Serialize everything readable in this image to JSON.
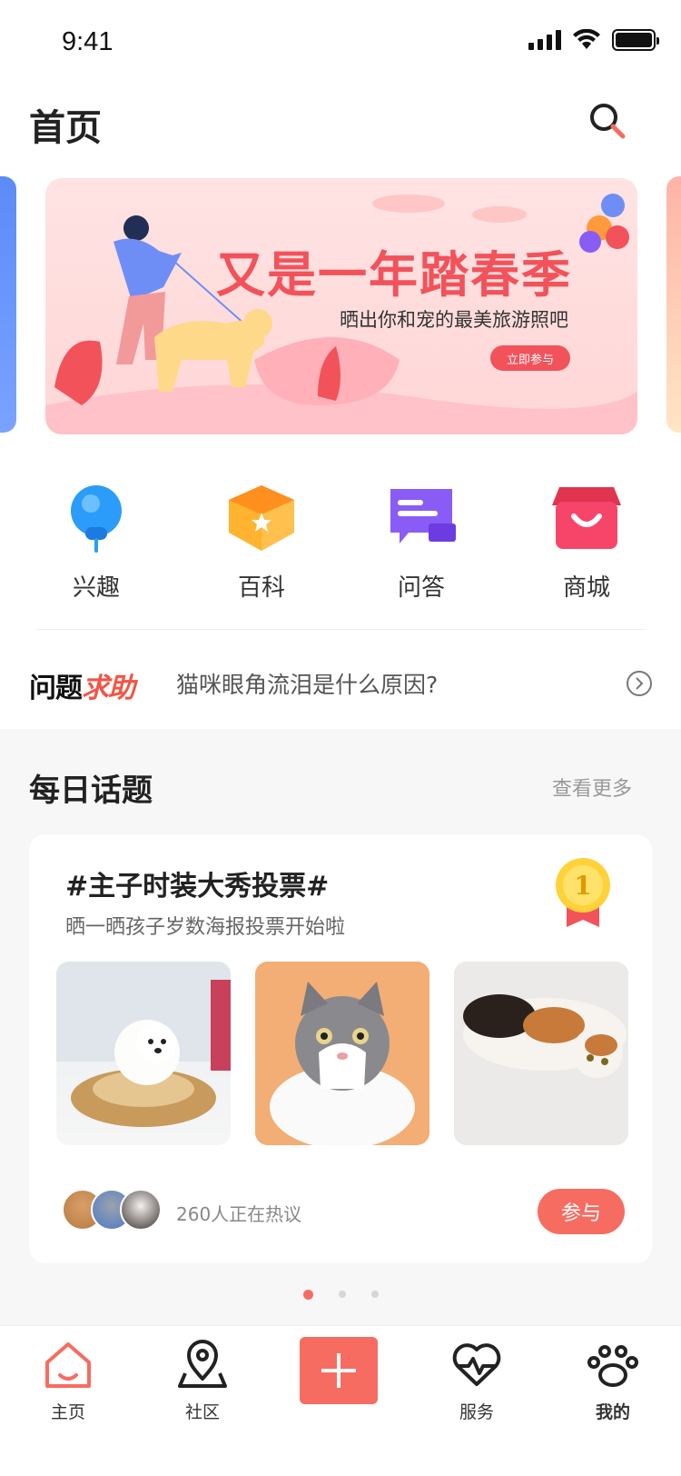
{
  "status": {
    "time": "9:41"
  },
  "header": {
    "title": "首页",
    "search_icon": "search-icon"
  },
  "banner": {
    "title": "又是一年踏春季",
    "subtitle": "晒出你和宠的最美旅游照吧",
    "button": "立即参与",
    "accent": "#f2525a"
  },
  "quick_nav": [
    {
      "label": "兴趣",
      "icon": "interest-balloon-icon"
    },
    {
      "label": "百科",
      "icon": "encyclopedia-box-icon"
    },
    {
      "label": "问答",
      "icon": "qa-chat-icon"
    },
    {
      "label": "商城",
      "icon": "shop-store-icon"
    }
  ],
  "qa": {
    "brand_dark": "问题",
    "brand_red": "求助",
    "question": "猫咪眼角流泪是什么原因?"
  },
  "daily": {
    "title": "每日话题",
    "more": "查看更多",
    "card": {
      "title": "#主子时装大秀投票#",
      "subtitle": "晒一晒孩子岁数海报投票开始啦",
      "medal_number": "1",
      "discussing": "260人正在热议",
      "join": "参与"
    },
    "pager": {
      "count": 3,
      "active": 0
    }
  },
  "tabs": [
    {
      "label": "主页",
      "icon": "home-icon",
      "active": true
    },
    {
      "label": "社区",
      "icon": "location-pin-icon",
      "active": false
    },
    {
      "label": "",
      "icon": "plus-icon",
      "active": false
    },
    {
      "label": "服务",
      "icon": "heart-pulse-icon",
      "active": false
    },
    {
      "label": "我的",
      "icon": "paw-icon",
      "active": false
    }
  ],
  "colors": {
    "primary": "#f76c60",
    "blue": "#2b9cf9",
    "orange": "#ffa726",
    "purple": "#8a5cf6",
    "pink": "#f7456a"
  }
}
